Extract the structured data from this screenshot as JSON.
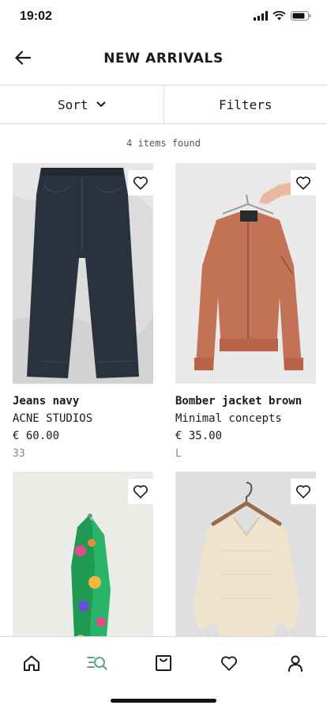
{
  "status_bar": {
    "time": "19:02"
  },
  "header": {
    "title": "NEW ARRIVALS"
  },
  "controls": {
    "sort_label": "Sort",
    "filters_label": "Filters"
  },
  "results": {
    "count_text": "4 items found"
  },
  "products": [
    {
      "name": "Jeans navy",
      "brand": "ACNE STUDIOS",
      "price": "€ 60.00",
      "size": "33"
    },
    {
      "name": "Bomber jacket brown",
      "brand": "Minimal concepts",
      "price": "€ 35.00",
      "size": "L"
    },
    {
      "name": "",
      "brand": "",
      "price": "",
      "size": ""
    },
    {
      "name": "",
      "brand": "",
      "price": "",
      "size": ""
    }
  ],
  "bottom_nav": {
    "items": [
      "home-icon",
      "discover-icon",
      "bag-icon",
      "heart-icon",
      "profile-icon"
    ],
    "active": "discover-icon"
  },
  "colors": {
    "text": "#1a1a1a",
    "divider": "#dcdcdc",
    "accent": "#5aa887",
    "muted": "#888888"
  }
}
